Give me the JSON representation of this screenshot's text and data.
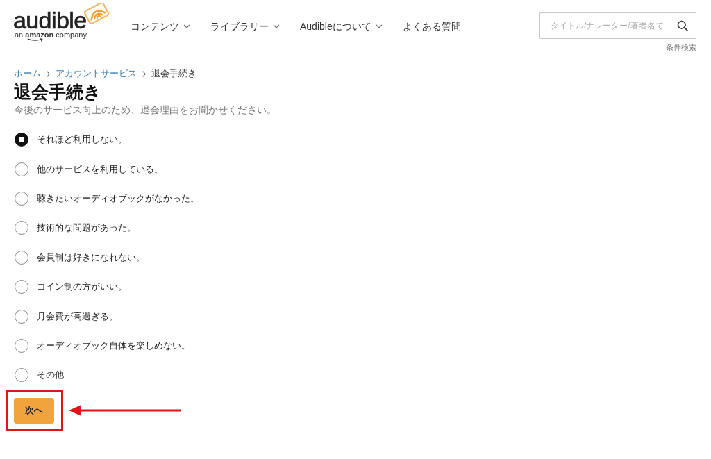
{
  "header": {
    "logo": {
      "wordmark": "audible",
      "tagline": "an **amazon** company"
    },
    "nav": [
      {
        "label": "コンテンツ",
        "dropdown": true
      },
      {
        "label": "ライブラリー",
        "dropdown": true
      },
      {
        "label": "Audibleについて",
        "dropdown": true
      },
      {
        "label": "よくある質問",
        "dropdown": false
      }
    ],
    "search": {
      "placeholder": "タイトル/ナレーター/著者名て"
    },
    "advanced_search_link": "条件検索"
  },
  "breadcrumb": [
    {
      "label": "ホーム",
      "current": false
    },
    {
      "label": "アカウントサービス",
      "current": false
    },
    {
      "label": "退会手続き",
      "current": true
    }
  ],
  "title": "退会手続き",
  "subtitle": "今後のサービス向上のため、退会理由をお聞かせください。",
  "reasons": [
    {
      "label": "それほど利用しない。",
      "selected": true
    },
    {
      "label": "他のサービスを利用している。",
      "selected": false
    },
    {
      "label": "聴きたいオーディオブックがなかった。",
      "selected": false
    },
    {
      "label": "技術的な問題があった。",
      "selected": false
    },
    {
      "label": "会員制は好きになれない。",
      "selected": false
    },
    {
      "label": "コイン制の方がいい。",
      "selected": false
    },
    {
      "label": "月会費が高過ぎる。",
      "selected": false
    },
    {
      "label": "オーディオブック自体を楽しめない。",
      "selected": false
    },
    {
      "label": "その他",
      "selected": false
    }
  ],
  "next_button": {
    "label": "次へ",
    "highlighted": true
  }
}
